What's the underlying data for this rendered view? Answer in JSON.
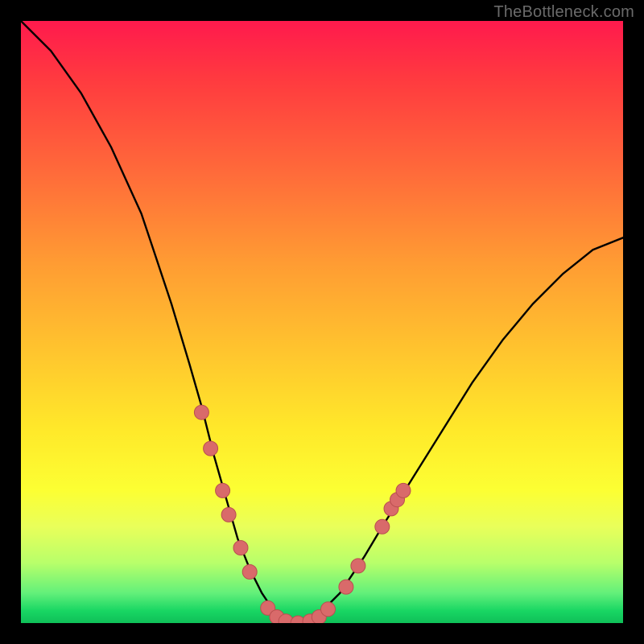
{
  "watermark": "TheBottleneck.com",
  "colors": {
    "frame": "#000000",
    "curve": "#000000",
    "dot_fill": "#d96a6a",
    "dot_stroke": "#b94f4f"
  },
  "chart_data": {
    "type": "line",
    "title": "",
    "xlabel": "",
    "ylabel": "",
    "xlim": [
      0,
      100
    ],
    "ylim": [
      0,
      100
    ],
    "grid": false,
    "legend": false,
    "series": [
      {
        "name": "bottleneck-curve",
        "x": [
          0,
          5,
          10,
          15,
          20,
          22,
          25,
          28,
          30,
          32,
          34,
          36,
          38,
          40,
          42,
          44,
          46,
          48,
          50,
          53,
          57,
          60,
          65,
          70,
          75,
          80,
          85,
          90,
          95,
          100
        ],
        "values": [
          100,
          95,
          88,
          79,
          68,
          62,
          53,
          43,
          36,
          28,
          21,
          14,
          9,
          5,
          2,
          0.5,
          0,
          0.5,
          2,
          5,
          11,
          16,
          24,
          32,
          40,
          47,
          53,
          58,
          62,
          64
        ]
      }
    ],
    "markers": [
      {
        "x": 30.0,
        "y": 35.0
      },
      {
        "x": 31.5,
        "y": 29.0
      },
      {
        "x": 33.5,
        "y": 22.0
      },
      {
        "x": 34.5,
        "y": 18.0
      },
      {
        "x": 36.5,
        "y": 12.5
      },
      {
        "x": 38.0,
        "y": 8.5
      },
      {
        "x": 41.0,
        "y": 2.5
      },
      {
        "x": 42.5,
        "y": 1.0
      },
      {
        "x": 44.0,
        "y": 0.3
      },
      {
        "x": 46.0,
        "y": 0.0
      },
      {
        "x": 48.0,
        "y": 0.3
      },
      {
        "x": 49.5,
        "y": 1.0
      },
      {
        "x": 51.0,
        "y": 2.3
      },
      {
        "x": 54.0,
        "y": 6.0
      },
      {
        "x": 56.0,
        "y": 9.5
      },
      {
        "x": 60.0,
        "y": 16.0
      },
      {
        "x": 61.5,
        "y": 19.0
      },
      {
        "x": 62.5,
        "y": 20.5
      },
      {
        "x": 63.5,
        "y": 22.0
      }
    ],
    "marker_radius_px": 9
  }
}
